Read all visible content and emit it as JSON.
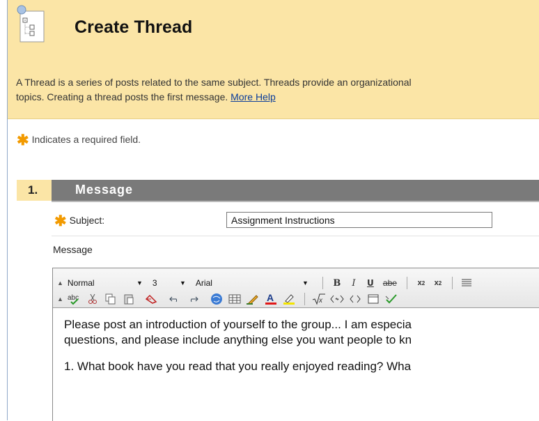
{
  "header": {
    "title": "Create Thread",
    "description": "A Thread is a series of posts related to the same subject. Threads provide an organizational",
    "description_line2": "topics. Creating a thread posts the first message.",
    "help_link": "More Help"
  },
  "required_note": "Indicates a required field.",
  "section": {
    "number": "1.",
    "title": "Message"
  },
  "form": {
    "subject_label": "Subject:",
    "subject_value": "Assignment Instructions",
    "message_label": "Message"
  },
  "editor": {
    "paragraph_format": "Normal",
    "font_size": "3",
    "font_family": "Arial",
    "toolbar_icons": [
      "bold-icon",
      "italic-icon",
      "underline-icon",
      "strikethrough-icon",
      "subscript-icon",
      "superscript-icon",
      "align-icon",
      "spellcheck-icon",
      "cut-icon",
      "copy-icon",
      "paste-icon",
      "clear-format-icon",
      "undo-icon",
      "redo-icon",
      "link-icon",
      "table-icon",
      "pencil-icon",
      "font-color-icon",
      "highlight-icon",
      "math-icon",
      "html-toggle-icon",
      "code-icon",
      "preview-icon",
      "check-icon"
    ],
    "content": {
      "line1": "Please post an introduction of yourself to the group... I am especia",
      "line2": "questions, and please include anything else you want people to kn",
      "line3": "1. What book have you read that you really enjoyed reading?   Wha"
    }
  },
  "colors": {
    "header_bg": "#fbe5a6",
    "section_bar": "#7a7a7a",
    "required_star": "#f29a00",
    "link": "#0b3d9a"
  }
}
